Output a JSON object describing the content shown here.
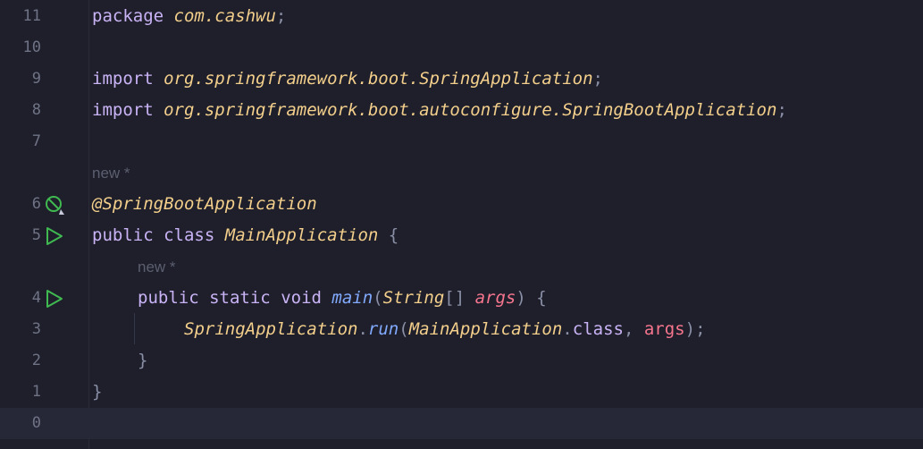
{
  "editor": {
    "lines": {
      "l11": {
        "num": "11",
        "package_kw": "package",
        "package_name": "com.cashwu",
        "semi": ";"
      },
      "l10": {
        "num": "10"
      },
      "l9": {
        "num": "9",
        "import_kw": "import",
        "import_path": "org.springframework.boot.SpringApplication",
        "semi": ";"
      },
      "l8": {
        "num": "8",
        "import_kw": "import",
        "import_path": "org.springframework.boot.autoconfigure.SpringBootApplication",
        "semi": ";"
      },
      "l7": {
        "num": "7"
      },
      "hint1": {
        "text": "new *"
      },
      "l6": {
        "num": "6",
        "annotation": "@SpringBootApplication",
        "icon": "bean-no-entry-icon"
      },
      "l5": {
        "num": "5",
        "kw_public": "public",
        "kw_class": "class",
        "class_name": "MainApplication",
        "brace": "{",
        "icon": "run-icon"
      },
      "hint2": {
        "text": "new *"
      },
      "l4": {
        "num": "4",
        "kw_public": "public",
        "kw_static": "static",
        "kw_void": "void",
        "method": "main",
        "lparen": "(",
        "type": "String",
        "brackets": "[]",
        "param": "args",
        "rparen": ")",
        "brace": "{",
        "icon": "run-icon"
      },
      "l3": {
        "num": "3",
        "cls": "SpringApplication",
        "dot": ".",
        "method": "run",
        "lparen": "(",
        "arg_cls": "MainApplication",
        "dot2": ".",
        "kw_class": "class",
        "comma": ",",
        "arg": "args",
        "rparen": ")",
        "semi": ";"
      },
      "l2": {
        "num": "2",
        "brace": "}"
      },
      "l1": {
        "num": "1",
        "brace": "}"
      },
      "l0": {
        "num": "0"
      }
    },
    "colors": {
      "background": "#1e1f2b",
      "keyword": "#c9b3f5",
      "class_name": "#f3cf8b",
      "method": "#82aaff",
      "parameter": "#f7768e",
      "gutter_icon": "#3fb950",
      "line_number": "#6f7385"
    }
  }
}
